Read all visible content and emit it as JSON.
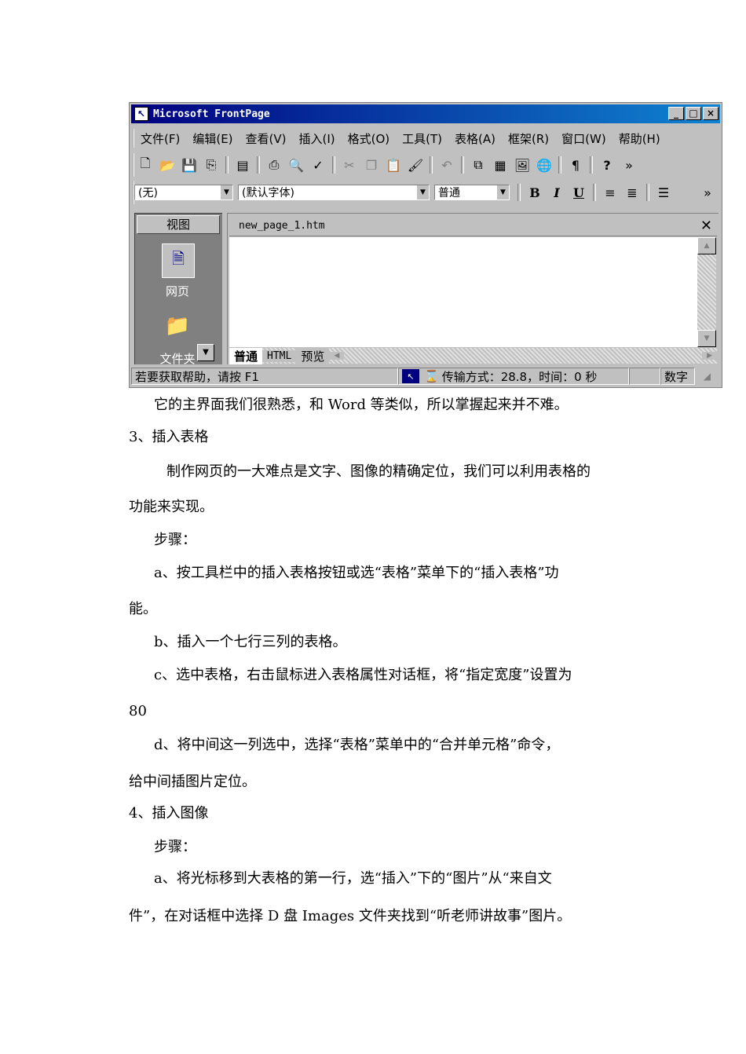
{
  "window": {
    "app_icon": "frontpage-icon",
    "title": "Microsoft FrontPage",
    "controls": {
      "minimize": "_",
      "maximize": "□",
      "close": "×"
    },
    "menu": [
      "文件(F)",
      "编辑(E)",
      "查看(V)",
      "插入(I)",
      "格式(O)",
      "工具(T)",
      "表格(A)",
      "框架(R)",
      "窗口(W)",
      "帮助(H)"
    ],
    "toolbar1_icons": [
      "new-page-icon",
      "open-icon",
      "save-icon",
      "publish-icon",
      "folder-list-icon",
      "print-icon",
      "print-preview-icon",
      "spelling-icon",
      "cut-icon",
      "copy-icon",
      "paste-icon",
      "format-painter-icon",
      "undo-icon",
      "insert-component-icon",
      "insert-table-icon",
      "insert-picture-icon",
      "hyperlink-icon",
      "paragraph-mark-icon",
      "help-icon",
      "more-icon"
    ],
    "style_combo": "(无)",
    "font_combo": "(默认字体)",
    "size_combo": "普通",
    "format_buttons": {
      "bold": "B",
      "italic": "I",
      "underline": "U",
      "more": "»",
      "paragraph_mark": "¶",
      "help": "?"
    },
    "views_header": "视图",
    "view_items": [
      "网页",
      "文件夹"
    ],
    "doc_tab": "new_page_1.htm",
    "view_tabs": [
      "普通",
      "HTML",
      "预览"
    ],
    "status": {
      "help": "若要获取帮助，请按 F1",
      "transfer": "传输方式：28.8，时间：0 秒",
      "mode": "数字"
    }
  },
  "body": {
    "intro": "它的主界面我们很熟悉，和 Word 等类似，所以掌握起来并不难。",
    "sec3_heading": "3、插入表格",
    "sec3_p1_line1": "制作网页的一大难点是文字、图像的精确定位，我们可以利用表格的",
    "sec3_p1_line2": "功能来实现。",
    "sec3_steps": "步骤：",
    "sec3_a_line1": "a、按工具栏中的插入表格按钮或选“表格”菜单下的“插入表格”功",
    "sec3_a_line2": "能。",
    "sec3_b": "b、插入一个七行三列的表格。",
    "sec3_c_line1": "c、选中表格，右击鼠标进入表格属性对话框，将“指定宽度”设置为",
    "sec3_c_line2": "80",
    "sec3_d_line1": "d、将中间这一列选中，选择“表格”菜单中的“合并单元格”命令，",
    "sec3_d_line2": "给中间插图片定位。",
    "sec4_heading": "4、插入图像",
    "sec4_steps": "步骤：",
    "sec4_a_line1": "a、将光标移到大表格的第一行，选“插入”下的“图片”从“来自文",
    "sec4_a_line2": "件”，在对话框中选择 D 盘 Images 文件夹找到“听老师讲故事”图片。"
  }
}
